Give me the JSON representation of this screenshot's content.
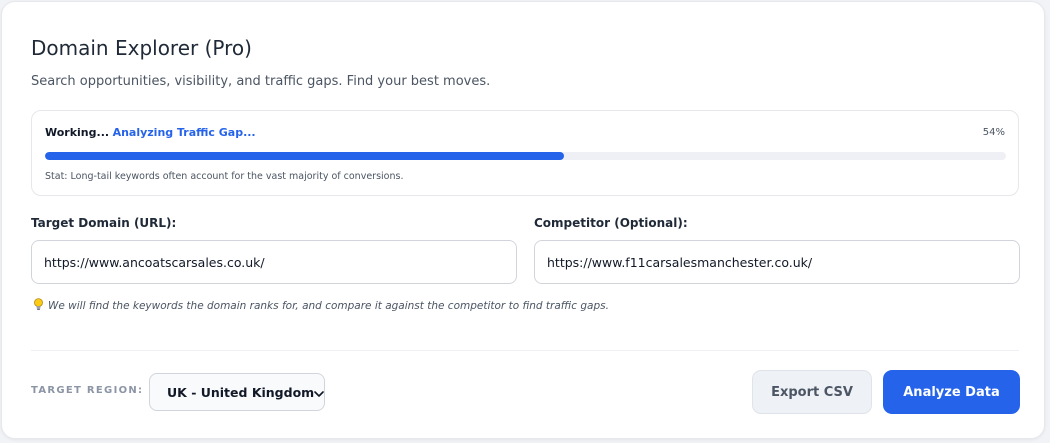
{
  "header": {
    "title": "Domain Explorer (Pro)",
    "subtitle": "Search opportunities, visibility, and traffic gaps. Find your best moves."
  },
  "progress": {
    "status_prefix": "Working...",
    "stage": "Analyzing Traffic Gap...",
    "percent_label": "54%",
    "percent_value": 54,
    "stat": "Stat: Long-tail keywords often account for the vast majority of conversions.",
    "accent_color": "#2563eb"
  },
  "form": {
    "target": {
      "label": "Target Domain (URL):",
      "value": "https://www.ancoatscarsales.co.uk/"
    },
    "competitor": {
      "label": "Competitor (Optional):",
      "value": "https://www.f11carsalesmanchester.co.uk/"
    },
    "hint_icon": "lightbulb-icon",
    "hint": "We will find the keywords the domain ranks for, and compare it against the competitor to find traffic gaps."
  },
  "footer": {
    "region_label": "TARGET REGION:",
    "region_value": "UK - United Kingdom",
    "export_label": "Export CSV",
    "analyze_label": "Analyze Data"
  }
}
